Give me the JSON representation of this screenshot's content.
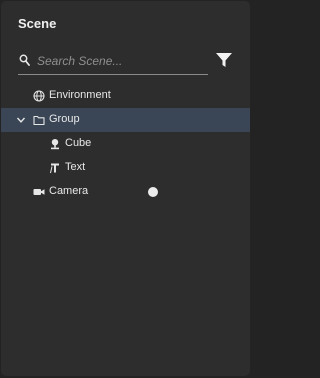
{
  "panel": {
    "title": "Scene"
  },
  "search": {
    "placeholder": "Search Scene..."
  },
  "tree": {
    "items": [
      {
        "label": "Environment",
        "icon": "globe-icon",
        "depth": 0,
        "expanded": null,
        "selected": false
      },
      {
        "label": "Group",
        "icon": "folder-icon",
        "depth": 0,
        "expanded": true,
        "selected": true
      },
      {
        "label": "Cube",
        "icon": "model-icon",
        "depth": 1,
        "expanded": null,
        "selected": false
      },
      {
        "label": "Text",
        "icon": "text-object-icon",
        "depth": 1,
        "expanded": null,
        "selected": false
      },
      {
        "label": "Camera",
        "icon": "camera-icon",
        "depth": 0,
        "expanded": null,
        "selected": false
      }
    ]
  },
  "colors": {
    "panel_background": "#2d2d2d",
    "selected_row": "#3a4656",
    "text": "#e8e8e8"
  }
}
